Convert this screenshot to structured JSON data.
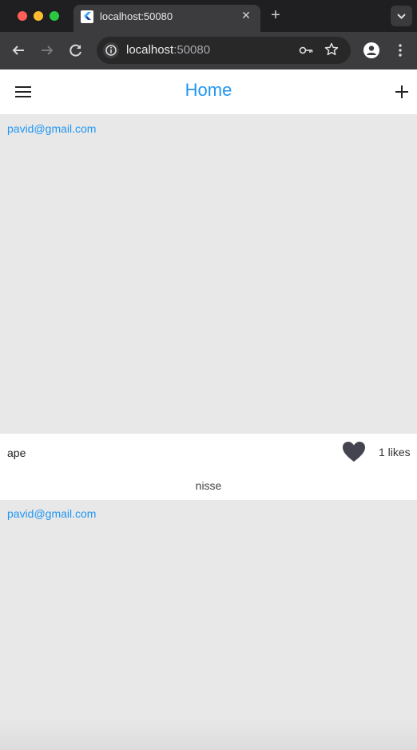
{
  "browser": {
    "tab_title": "localhost:50080",
    "url_host": "localhost",
    "url_port": ":50080"
  },
  "appbar": {
    "title": "Home"
  },
  "posts": [
    {
      "email": "pavid@gmail.com",
      "caption": "ape",
      "likes": "1 likes",
      "comment": "nisse"
    },
    {
      "email": "pavid@gmail.com"
    }
  ],
  "colors": {
    "accent": "#2196f3",
    "background": "#e8e8e8",
    "heart": "#444450"
  }
}
